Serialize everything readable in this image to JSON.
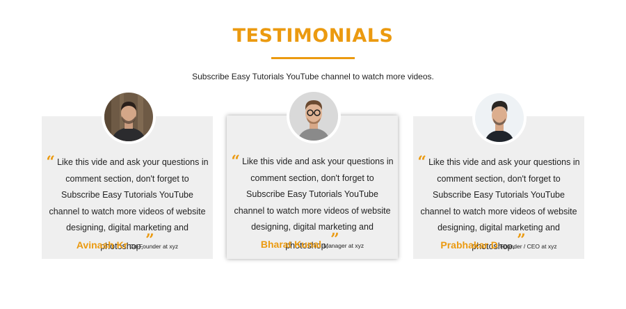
{
  "header": {
    "title": "TESTIMONIALS",
    "subtitle": "Subscribe Easy Tutorials YouTube channel to watch more videos."
  },
  "testimonials": [
    {
      "quote": "Like this vide and ask your questions in comment section, don't forget to Subscribe Easy Tutorials YouTube channel to watch more videos of website designing, digital marketing and photoshop.",
      "name": "Avinash Kr",
      "role": "Co-Founder at xyz"
    },
    {
      "quote": "Like this vide and ask your questions in comment section, don't forget to Subscribe Easy Tutorials YouTube channel to watch more videos of website designing, digital marketing and photoshop.",
      "name": "Bharat Kunal",
      "role": "Manager at xyz"
    },
    {
      "quote": "Like this vide and ask your questions in comment section, don't forget to Subscribe Easy Tutorials YouTube channel to watch more videos of website designing, digital marketing and photoshop.",
      "name": "Prabhakar D",
      "role": "Founder / CEO at xyz"
    }
  ],
  "icons": {
    "open_quote": "“",
    "close_quote": "”"
  },
  "colors": {
    "accent": "#eb9a10",
    "card_bg": "#efefef"
  }
}
